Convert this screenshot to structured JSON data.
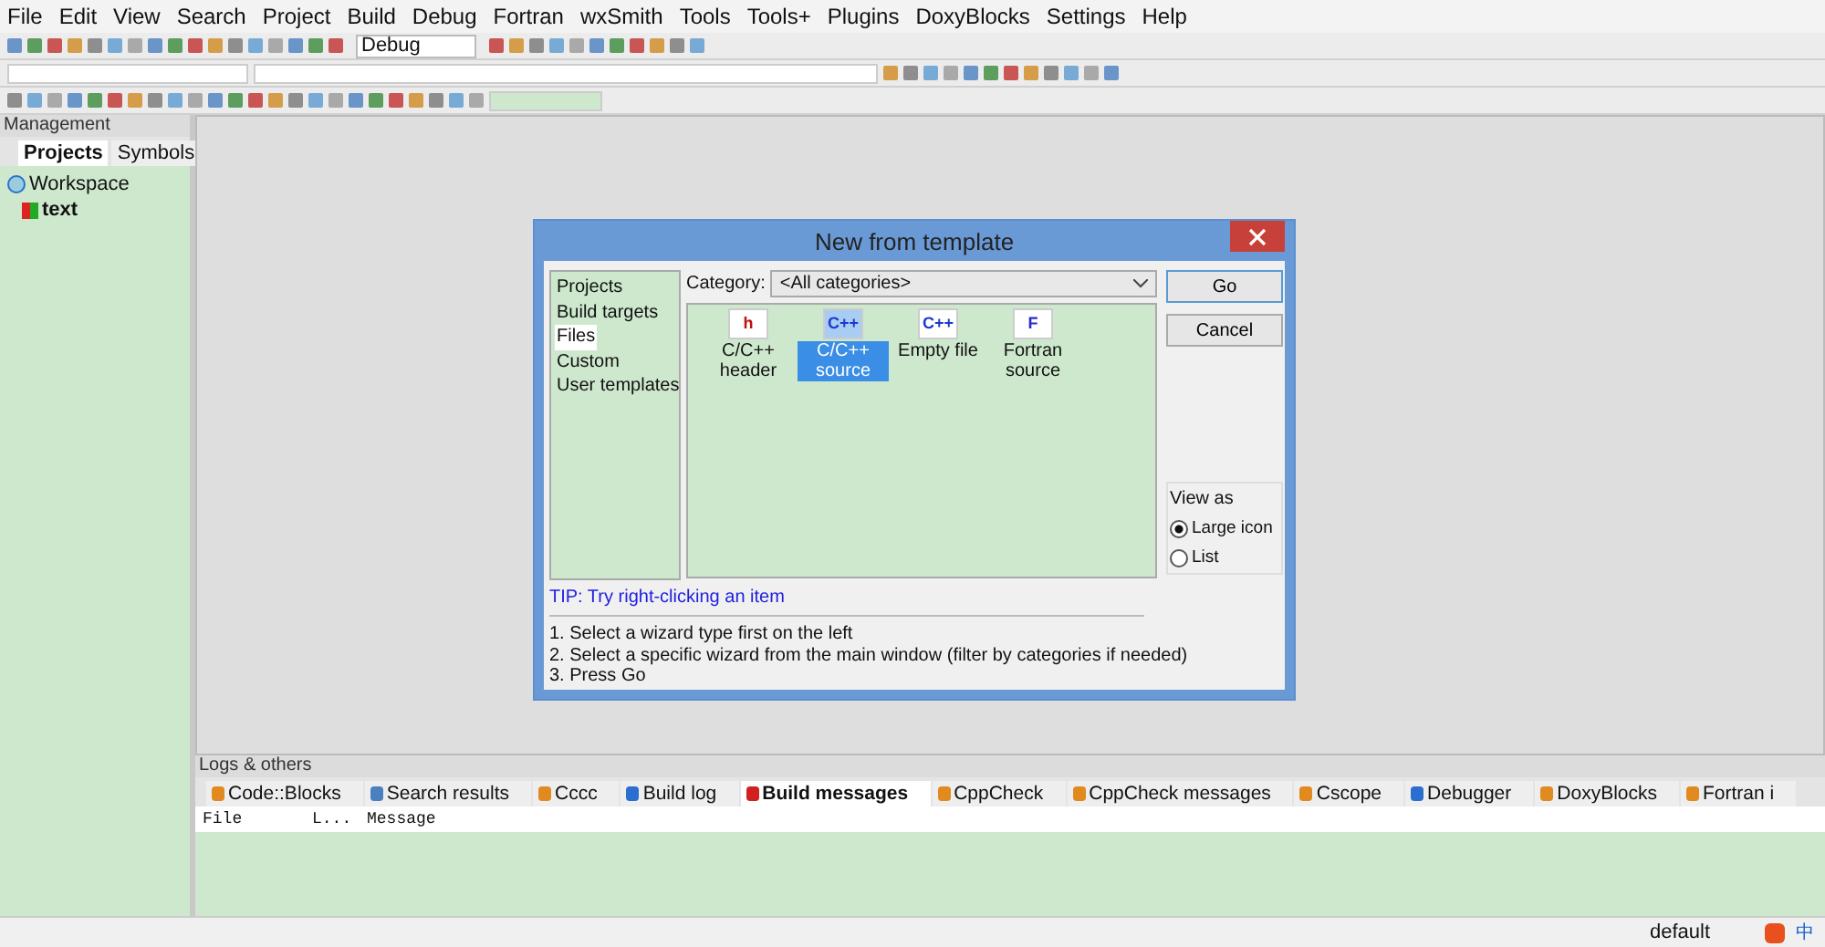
{
  "menu": [
    "File",
    "Edit",
    "View",
    "Search",
    "Project",
    "Build",
    "Debug",
    "Fortran",
    "wxSmith",
    "Tools",
    "Tools+",
    "Plugins",
    "DoxyBlocks",
    "Settings",
    "Help"
  ],
  "toolbar": {
    "build_target": "Debug"
  },
  "management": {
    "title": "Management",
    "tabs": [
      {
        "label": "Projects",
        "selected": true
      },
      {
        "label": "Symbols",
        "selected": false
      }
    ],
    "tree": [
      {
        "label": "Workspace",
        "children": [
          {
            "label": "text"
          }
        ]
      }
    ]
  },
  "dialog": {
    "title": "New from template",
    "categories": [
      {
        "label": "Projects",
        "selected": false
      },
      {
        "label": "Build targets",
        "selected": false
      },
      {
        "label": "Files",
        "selected": true
      },
      {
        "label": "Custom",
        "selected": false
      },
      {
        "label": "User templates",
        "selected": false
      }
    ],
    "category_label": "Category:",
    "category_value": "<All categories>",
    "templates": [
      {
        "label": "C/C++ header",
        "glyph": "h",
        "kind": "header",
        "selected": false
      },
      {
        "label": "C/C++ source",
        "glyph": "C++",
        "kind": "cpp",
        "selected": true
      },
      {
        "label": "Empty file",
        "glyph": "C++",
        "kind": "cpp",
        "selected": false
      },
      {
        "label": "Fortran source",
        "glyph": "F",
        "kind": "fortran",
        "selected": false
      }
    ],
    "buttons": [
      "Go",
      "Cancel"
    ],
    "view_as": {
      "title": "View as",
      "options": [
        {
          "label": "Large icon",
          "selected": true
        },
        {
          "label": "List",
          "selected": false
        }
      ]
    },
    "tip": "TIP: Try right-clicking an item",
    "steps": [
      "1. Select a wizard type first on the left",
      "2. Select a specific wizard from the main window (filter by categories if needed)",
      "3. Press Go"
    ]
  },
  "logs": {
    "title": "Logs & others",
    "tabs": [
      {
        "label": "Code::Blocks",
        "kind": "note",
        "selected": false
      },
      {
        "label": "Search results",
        "kind": "search",
        "selected": false
      },
      {
        "label": "Cccc",
        "kind": "note",
        "selected": false
      },
      {
        "label": "Build log",
        "kind": "gear",
        "selected": false
      },
      {
        "label": "Build messages",
        "kind": "pin",
        "selected": true
      },
      {
        "label": "CppCheck",
        "kind": "note",
        "selected": false
      },
      {
        "label": "CppCheck messages",
        "kind": "note",
        "selected": false
      },
      {
        "label": "Cscope",
        "kind": "note",
        "selected": false
      },
      {
        "label": "Debugger",
        "kind": "gear",
        "selected": false
      },
      {
        "label": "DoxyBlocks",
        "kind": "note",
        "selected": false
      },
      {
        "label": "Fortran i",
        "kind": "note",
        "selected": false
      }
    ],
    "columns": [
      "File",
      "L...",
      "Message"
    ]
  },
  "status_bar": {
    "text": "default",
    "ime": "中"
  }
}
